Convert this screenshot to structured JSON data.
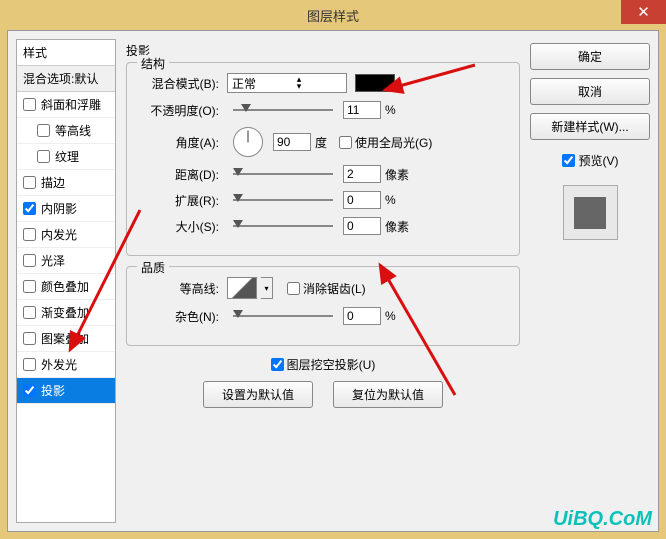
{
  "title": "图层样式",
  "close_icon": "✕",
  "left": {
    "header": "样式",
    "subheader": "混合选项:默认",
    "items": [
      {
        "label": "斜面和浮雕",
        "checked": false,
        "indent": false
      },
      {
        "label": "等高线",
        "checked": false,
        "indent": true
      },
      {
        "label": "纹理",
        "checked": false,
        "indent": true
      },
      {
        "label": "描边",
        "checked": false,
        "indent": false
      },
      {
        "label": "内阴影",
        "checked": true,
        "indent": false
      },
      {
        "label": "内发光",
        "checked": false,
        "indent": false
      },
      {
        "label": "光泽",
        "checked": false,
        "indent": false
      },
      {
        "label": "颜色叠加",
        "checked": false,
        "indent": false
      },
      {
        "label": "渐变叠加",
        "checked": false,
        "indent": false
      },
      {
        "label": "图案叠加",
        "checked": false,
        "indent": false
      },
      {
        "label": "外发光",
        "checked": false,
        "indent": false
      },
      {
        "label": "投影",
        "checked": true,
        "indent": false,
        "selected": true
      }
    ]
  },
  "center": {
    "section": "投影",
    "group1": "结构",
    "blend_mode_label": "混合模式(B):",
    "blend_mode_value": "正常",
    "opacity_label": "不透明度(O):",
    "opacity_value": "11",
    "opacity_unit": "%",
    "angle_label": "角度(A):",
    "angle_value": "90",
    "angle_unit": "度",
    "global_light_label": "使用全局光(G)",
    "distance_label": "距离(D):",
    "distance_value": "2",
    "distance_unit": "像素",
    "spread_label": "扩展(R):",
    "spread_value": "0",
    "spread_unit": "%",
    "size_label": "大小(S):",
    "size_value": "0",
    "size_unit": "像素",
    "group2": "品质",
    "contour_label": "等高线:",
    "antialias_label": "消除锯齿(L)",
    "noise_label": "杂色(N):",
    "noise_value": "0",
    "noise_unit": "%",
    "knockout_label": "图层挖空投影(U)",
    "default_btn": "设置为默认值",
    "reset_btn": "复位为默认值"
  },
  "right": {
    "ok": "确定",
    "cancel": "取消",
    "new_style": "新建样式(W)...",
    "preview": "预览(V)"
  },
  "watermark": "UiBQ.CoM",
  "colors": {
    "arrow": "#d90f0f"
  }
}
